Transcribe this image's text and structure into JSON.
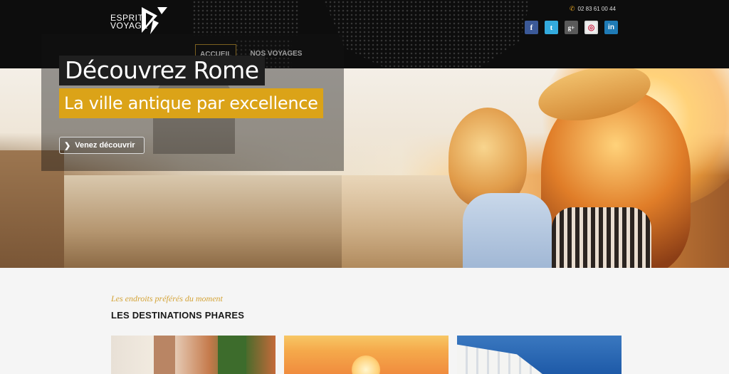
{
  "header": {
    "logo": {
      "line1": "ESPRIT",
      "line2": "VOYAGE"
    },
    "phone": "02 83 61 00 44",
    "socials": [
      {
        "name": "facebook",
        "glyph": "f"
      },
      {
        "name": "twitter",
        "glyph": "t"
      },
      {
        "name": "google-plus",
        "glyph": "g+"
      },
      {
        "name": "instagram",
        "glyph": "◎"
      },
      {
        "name": "linkedin",
        "glyph": "in"
      }
    ],
    "nav": [
      {
        "label": "ACCUEIL",
        "active": true
      },
      {
        "label": "NOS VOYAGES",
        "active": false
      }
    ]
  },
  "hero": {
    "title": "Découvrez Rome",
    "subtitle": "La ville antique par excellence",
    "cta": "Venez découvrir"
  },
  "destinations": {
    "kicker": "Les endroits préférés du moment",
    "title": "LES DESTINATIONS PHARES"
  },
  "colors": {
    "accent": "#dba318",
    "header_bg": "#0d0d0d",
    "nav_active_border": "#c89a2a"
  }
}
